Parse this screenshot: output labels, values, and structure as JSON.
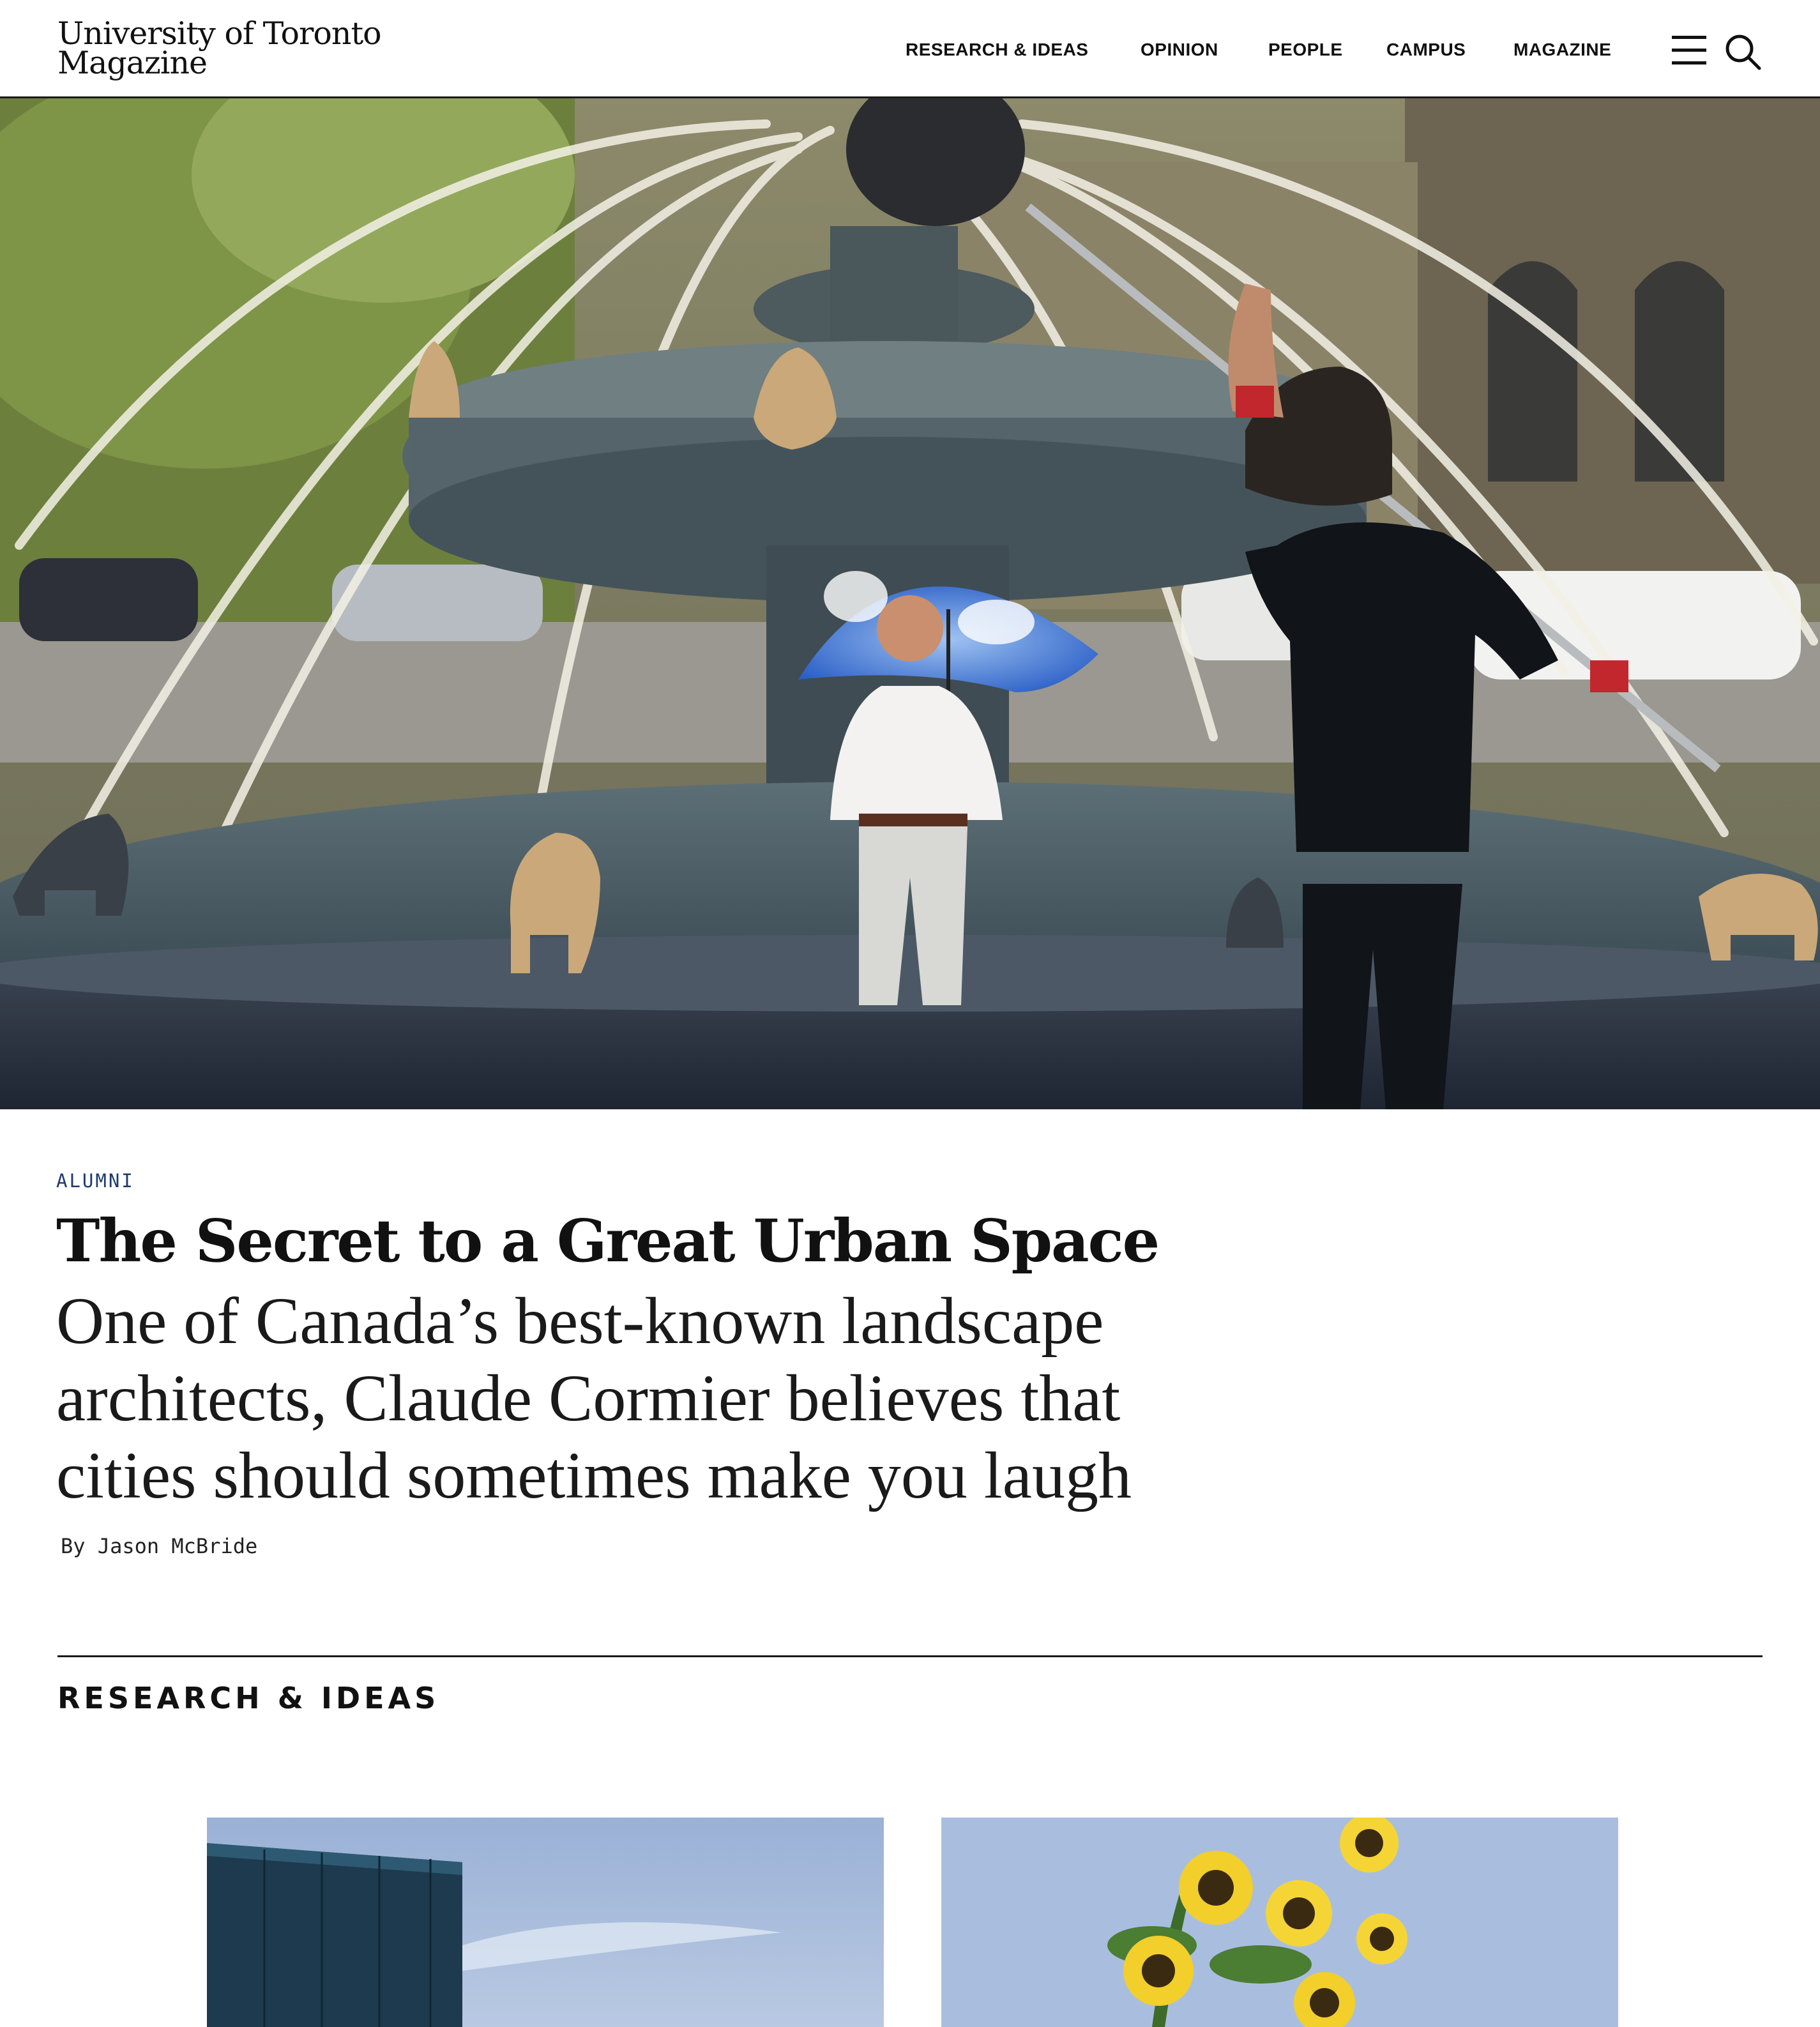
{
  "header": {
    "logo_line1": "University of Toronto",
    "logo_line2": "Magazine",
    "nav": [
      "RESEARCH & IDEAS",
      "OPINION",
      "PEOPLE",
      "CAMPUS",
      "MAGAZINE"
    ],
    "menu_icon": "hamburger-menu-icon",
    "search_icon": "search-icon"
  },
  "hero": {
    "image": "fountain-with-dog-statues-and-man-holding-umbrella-photo"
  },
  "article": {
    "category": "ALUMNI",
    "title": "The Secret to a Great Urban Space",
    "deck": "One of Canada’s best-known landscape architects, Claude Cormier believes that cities should sometimes make you laugh",
    "byline": "By Jason McBride"
  },
  "section": {
    "title": "RESEARCH & IDEAS"
  },
  "cards": [
    {
      "image": "modern-building-facade-against-sky-photo"
    },
    {
      "image": "sunflowers-against-blue-sky-photo"
    }
  ],
  "colors": {
    "category": "#1e3a6e",
    "text": "#111111",
    "rule": "#1a1a1a"
  }
}
